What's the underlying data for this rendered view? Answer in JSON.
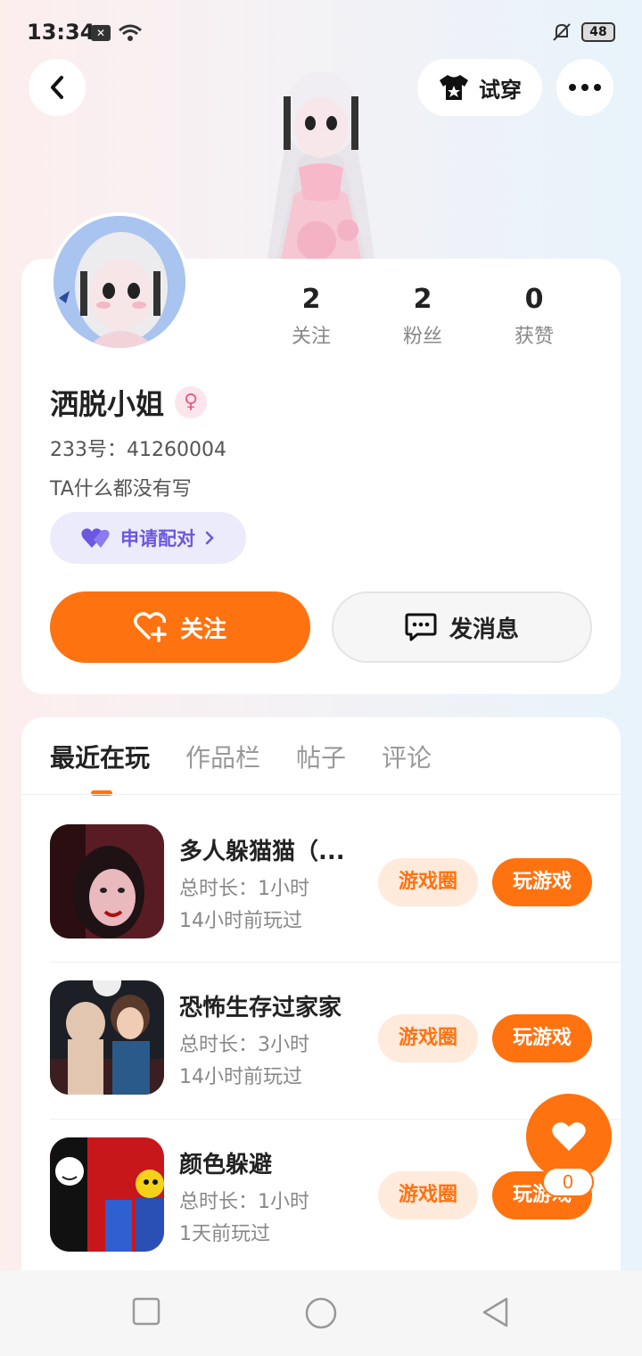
{
  "status_bar": {
    "time": "13:34",
    "battery": "48"
  },
  "header": {
    "try_on_label": "试穿"
  },
  "profile": {
    "stats": [
      {
        "value": "2",
        "label": "关注"
      },
      {
        "value": "2",
        "label": "粉丝"
      },
      {
        "value": "0",
        "label": "获赞"
      }
    ],
    "username": "洒脱小姐",
    "uid": "233号：41260004",
    "bio": "TA什么都没有写",
    "pair_label": "申请配对",
    "follow_label": "关注",
    "message_label": "发消息"
  },
  "tabs": [
    {
      "label": "最近在玩",
      "active": true
    },
    {
      "label": "作品栏",
      "active": false
    },
    {
      "label": "帖子",
      "active": false
    },
    {
      "label": "评论",
      "active": false
    }
  ],
  "games": [
    {
      "title": "多人躲猫猫（...",
      "duration": "总时长：1小时",
      "last_played": "14小时前玩过",
      "circle_label": "游戏圈",
      "play_label": "玩游戏"
    },
    {
      "title": "恐怖生存过家家",
      "duration": "总时长：3小时",
      "last_played": "14小时前玩过",
      "circle_label": "游戏圈",
      "play_label": "玩游戏"
    },
    {
      "title": "颜色躲避",
      "duration": "总时长：1小时",
      "last_played": "1天前玩过",
      "circle_label": "游戏圈",
      "play_label": "玩游戏"
    }
  ],
  "fab": {
    "like_count": "0"
  },
  "colors": {
    "accent": "#ff7210",
    "pair": "#6b57e0"
  }
}
